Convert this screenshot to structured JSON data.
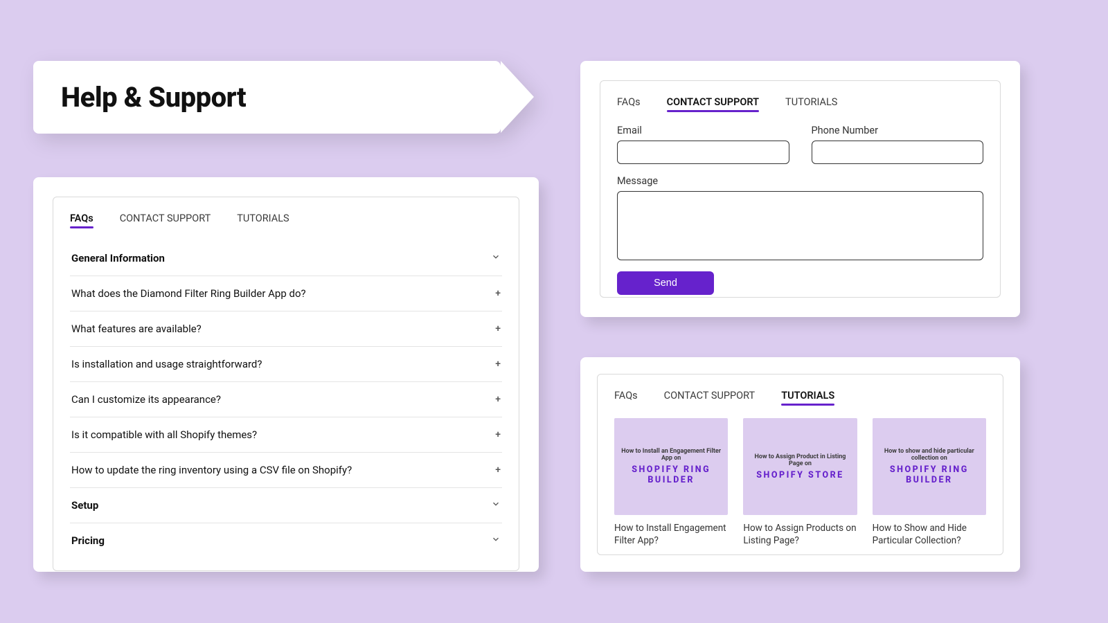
{
  "hero": {
    "title": "Help & Support"
  },
  "tabs": {
    "faqs": "FAQs",
    "contact": "CONTACT SUPPORT",
    "tutorials": "TUTORIALS"
  },
  "faq": {
    "sections": [
      {
        "title": "General Information",
        "expanded": true
      },
      {
        "title": "Setup",
        "expanded": false
      },
      {
        "title": "Pricing",
        "expanded": false
      }
    ],
    "general_items": [
      "What does the Diamond Filter Ring Builder App do?",
      "What features are available?",
      "Is installation and usage straightforward?",
      "Can I customize its appearance?",
      "Is it compatible with all Shopify themes?",
      "How to update the ring inventory using a CSV file on Shopify?"
    ]
  },
  "contact": {
    "email_label": "Email",
    "phone_label": "Phone Number",
    "message_label": "Message",
    "send_label": "Send"
  },
  "tutorials": [
    {
      "thumb_line1": "How to Install an Engagement Filter App on",
      "thumb_line2": "SHOPIFY RING BUILDER",
      "caption": "How to Install Engagement Filter App?"
    },
    {
      "thumb_line1": "How to Assign Product in Listing Page on",
      "thumb_line2": "SHOPIFY STORE",
      "caption": "How to Assign Products on Listing Page?"
    },
    {
      "thumb_line1": "How to show and hide particular collection on",
      "thumb_line2": "SHOPIFY RING BUILDER",
      "caption": "How to Show and Hide Particular Collection?"
    }
  ]
}
